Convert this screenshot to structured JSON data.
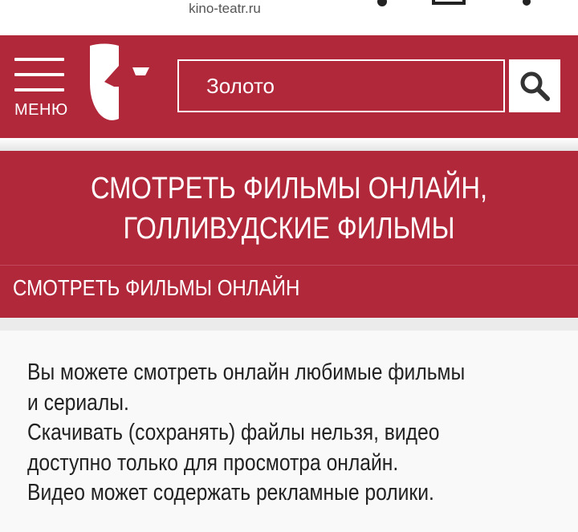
{
  "browser": {
    "url": "kino-teatr.ru"
  },
  "header": {
    "menu_label": "МЕНЮ",
    "logo_icon": "theatre-mask-logo-icon",
    "search": {
      "value": "Золото",
      "button_icon": "search-icon"
    },
    "colors": {
      "brand": "#b0283a",
      "foreground": "#ffffff"
    }
  },
  "banner": {
    "title_line1": "СМОТРЕТЬ ФИЛЬМЫ ОНЛАЙН,",
    "title_line2": "ГОЛЛИВУДСКИЕ ФИЛЬМЫ",
    "subtitle": "СМОТРЕТЬ ФИЛЬМЫ ОНЛАЙН"
  },
  "notice": {
    "lines": [
      "Вы можете смотреть онлайн любимые фильмы",
      "и сериалы.",
      "Скачивать (сохранять) файлы нельзя, видео",
      "доступно только для просмотра онлайн.",
      "Видео может содержать рекламные ролики."
    ]
  }
}
